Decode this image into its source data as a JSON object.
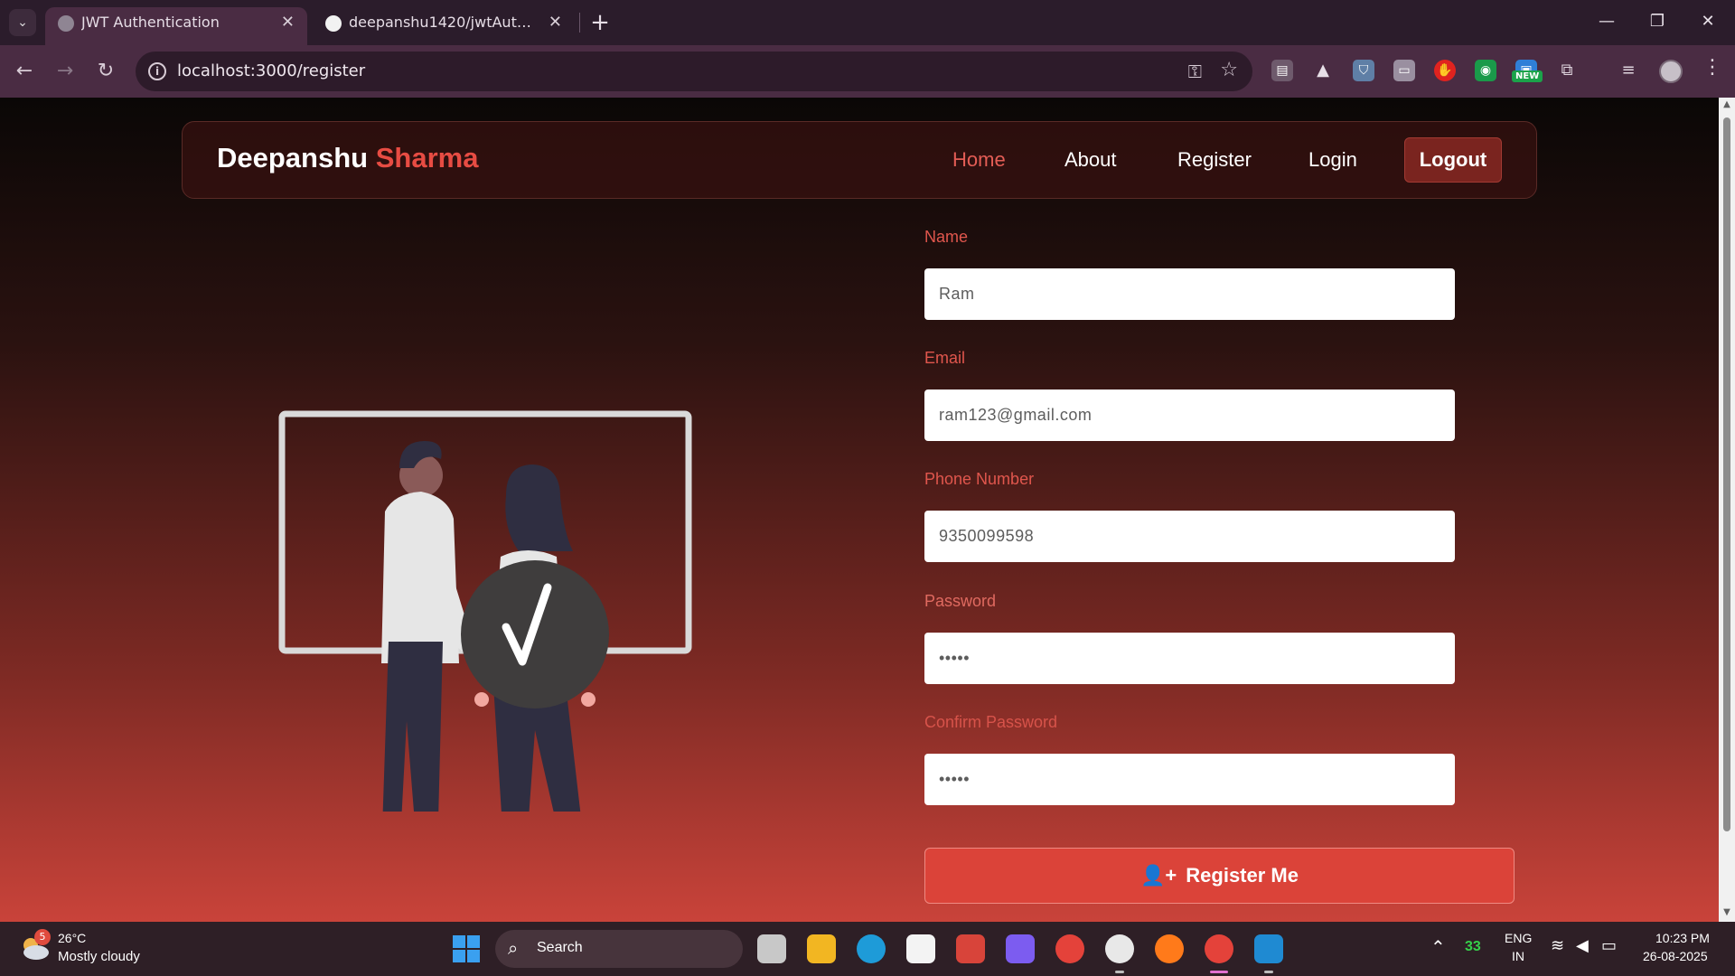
{
  "browser": {
    "tabs": [
      {
        "title": "JWT Authentication",
        "active": true
      },
      {
        "title": "deepanshu1420/jwtAuthentication",
        "active": false
      }
    ],
    "new_tab_label": "+",
    "url": "localhost:3000/register",
    "extension_badge": "NEW"
  },
  "site": {
    "brand_first": "Deepanshu",
    "brand_last": "Sharma",
    "nav": {
      "home": "Home",
      "about": "About",
      "register": "Register",
      "login": "Login",
      "logout": "Logout"
    },
    "accent_color": "#e74c43"
  },
  "form": {
    "name": {
      "label": "Name",
      "value": "Ram"
    },
    "email": {
      "label": "Email",
      "value": "ram123@gmail.com"
    },
    "phone": {
      "label": "Phone Number",
      "value": "9350099598"
    },
    "password": {
      "label": "Password",
      "value": "•••••"
    },
    "confirm_password": {
      "label": "Confirm Password",
      "value": "•••••"
    },
    "submit_label": "Register Me"
  },
  "taskbar": {
    "weather_badge": "5",
    "weather_temp": "26°C",
    "weather_desc": "Mostly cloudy",
    "search_label": "Search",
    "tray_count": "33",
    "lang_line1": "ENG",
    "lang_line2": "IN",
    "time": "10:23 PM",
    "date": "26-08-2025"
  }
}
